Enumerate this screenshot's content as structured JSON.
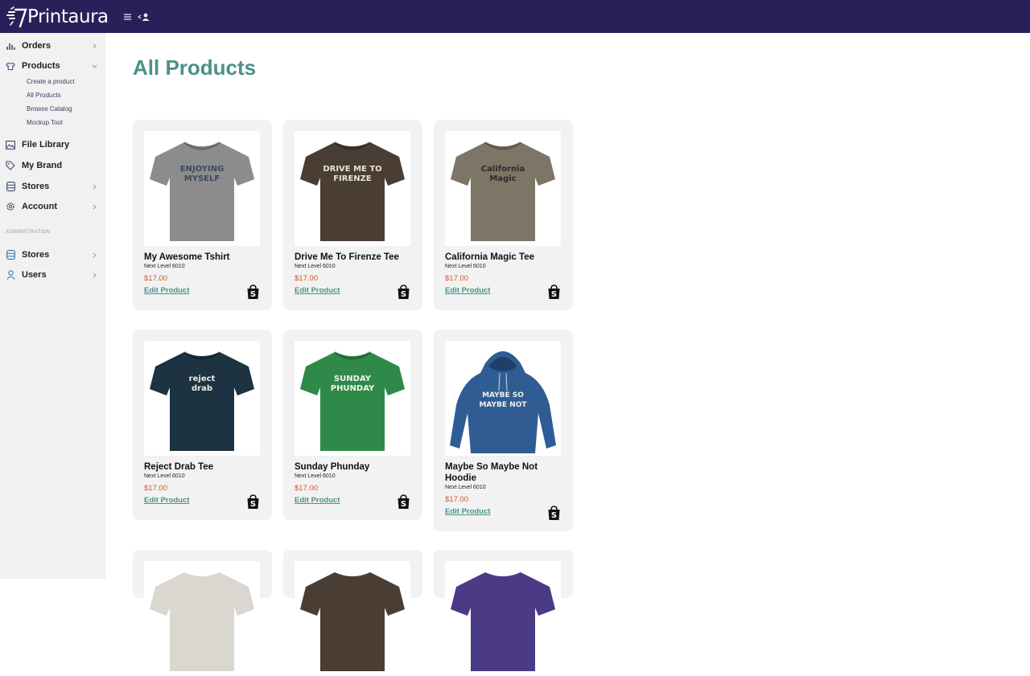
{
  "brand": {
    "name": "Printaura"
  },
  "sidebar": {
    "items": [
      {
        "label": "Orders",
        "icon": "bar-chart-icon"
      },
      {
        "label": "Products",
        "icon": "tshirt-icon"
      },
      {
        "label": "File Library",
        "icon": "image-icon"
      },
      {
        "label": "My Brand",
        "icon": "tag-icon"
      },
      {
        "label": "Stores",
        "icon": "database-icon"
      },
      {
        "label": "Account",
        "icon": "gear-icon"
      }
    ],
    "product_subitems": [
      "Create a product",
      "All Products",
      "Browse Catalog",
      "Mockup Tool"
    ],
    "admin_label": "ADMINISTRATION",
    "admin_items": [
      {
        "label": "Stores",
        "icon": "database-icon"
      },
      {
        "label": "Users",
        "icon": "user-icon"
      }
    ]
  },
  "main": {
    "title": "All Products",
    "products": [
      {
        "name": "My Awesome Tshirt",
        "sub": "Next Level 6010",
        "price": "$17.00",
        "edit": "Edit Product",
        "shirt_color": "#8c8c8c",
        "print_lines": [
          "ENJOYING",
          "MYSELF"
        ],
        "print_color": "#3e4a5c"
      },
      {
        "name": "Drive Me To Firenze Tee",
        "sub": "Next Level 6010",
        "price": "$17.00",
        "edit": "Edit Product",
        "shirt_color": "#4a3d33",
        "print_lines": [
          "DRIVE ME TO",
          "FIRENZE"
        ],
        "print_color": "#e8e2d6"
      },
      {
        "name": "California Magic Tee",
        "sub": "Next Level 6010",
        "price": "$17.00",
        "edit": "Edit Product",
        "shirt_color": "#7d7566",
        "print_lines": [
          "California",
          "Magic"
        ],
        "print_color": "#2b2a30"
      },
      {
        "name": "Reject Drab Tee",
        "sub": "Next Level 6010",
        "price": "$17.00",
        "edit": "Edit Product",
        "shirt_color": "#1d3341",
        "print_lines": [
          "reject",
          "drab"
        ],
        "print_color": "#f0ede4"
      },
      {
        "name": "Sunday Phunday",
        "sub": "Next Level 6010",
        "price": "$17.00",
        "edit": "Edit Product",
        "shirt_color": "#2f8a4a",
        "print_lines": [
          "SUNDAY",
          "PHUNDAY"
        ],
        "print_color": "#f4f4ec"
      },
      {
        "name": "Maybe So Maybe Not Hoodie",
        "sub": "Next Level 6010",
        "price": "$17.00",
        "edit": "Edit Product",
        "shirt_color": "#2f5c93",
        "print_lines": [
          "MAYBE SO",
          "MAYBE NOT"
        ],
        "print_color": "#f2f2f2",
        "hoodie": true
      }
    ],
    "partial_row_colors": [
      "#d9d7cf",
      "#4a3d33",
      "#4b3a86"
    ]
  },
  "colors": {
    "accent": "#4a9189",
    "topbar": "#2a2059",
    "price": "#d25a2c"
  }
}
